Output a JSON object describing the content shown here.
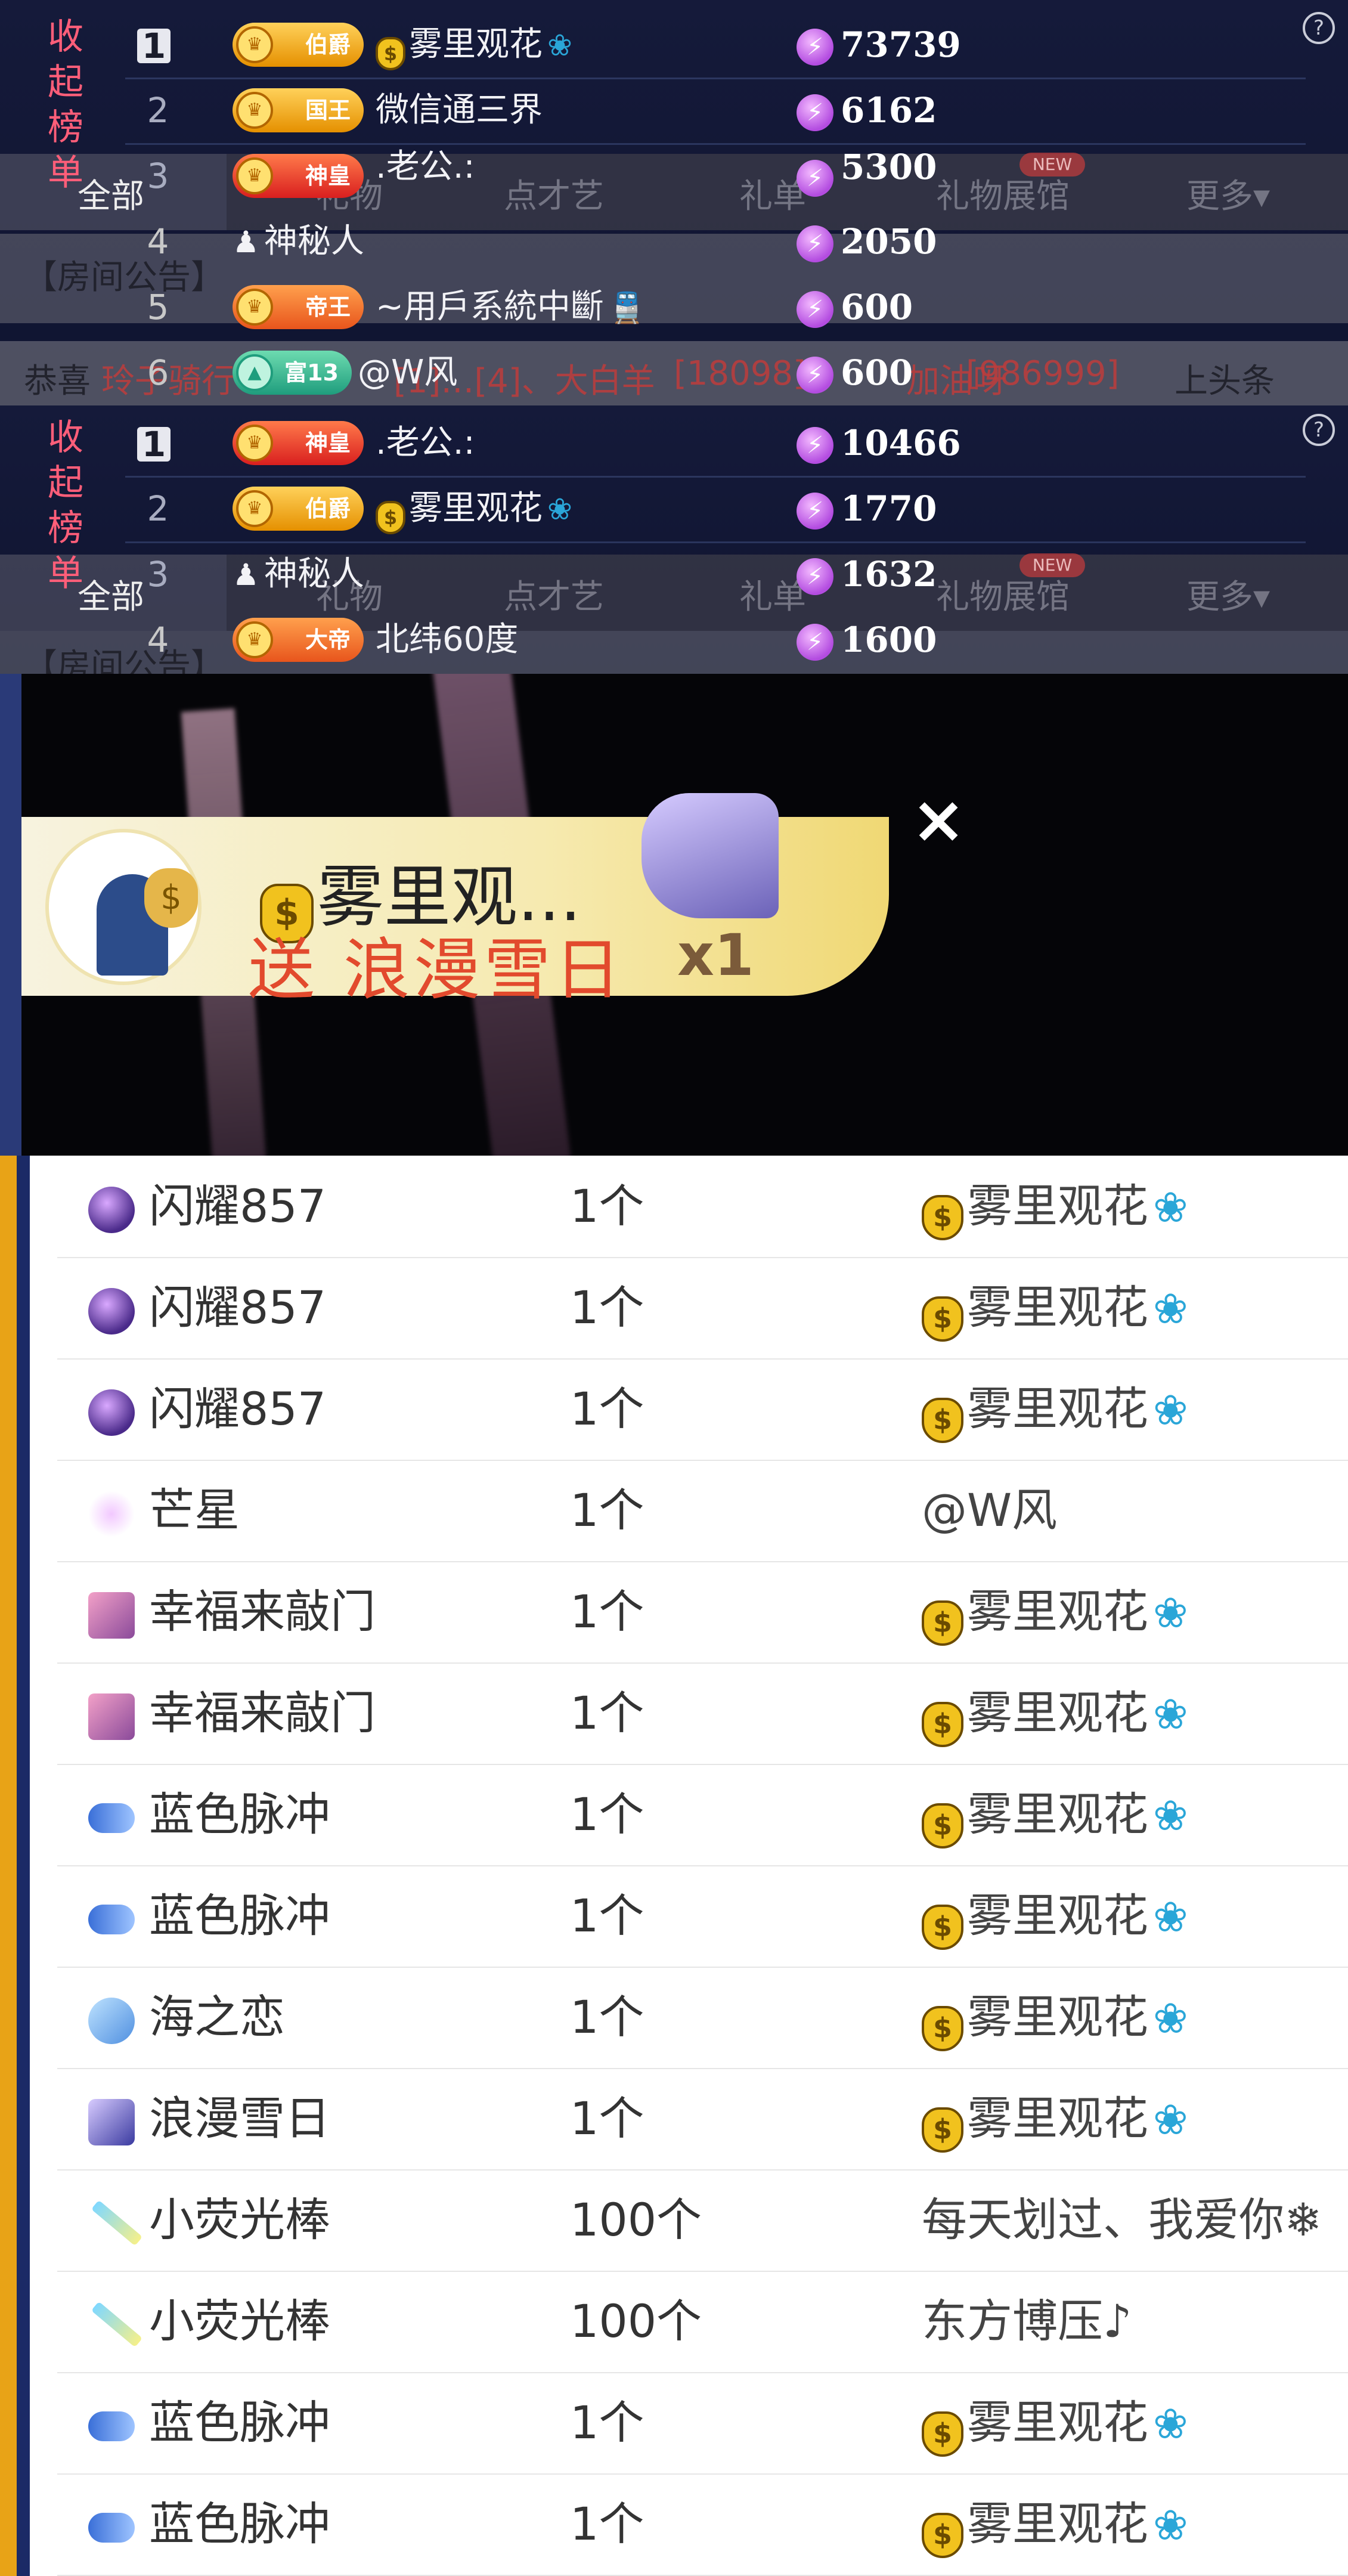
{
  "rank_panels": [
    {
      "side_label": "收起榜单",
      "help_icon": "?",
      "ghost_tabs": {
        "all": "全部",
        "t2": "礼物",
        "t3": "点才艺",
        "t4": "礼单",
        "t5": "礼物展馆",
        "new_badge": "NEW",
        "more": "更多▾"
      },
      "ghost_notice": "【房间公告】",
      "ghost_congrats": {
        "prefix": "恭喜",
        "names": "玲子骑行",
        "mid": "[1]…[4]、大白羊",
        "id1": "[18098]",
        "mid2": "加油呀",
        "id2": "[986999]",
        "suffix": "上头条"
      },
      "rows": [
        {
          "rank": "1",
          "badge": "伯爵",
          "badge_style": "gold",
          "name_prefix_icon": "moneybag",
          "name": "雾里观花",
          "name_suffix_icon": "drops",
          "score": "73739"
        },
        {
          "rank": "2",
          "badge": "国王",
          "badge_style": "gold",
          "name": "微信通三界",
          "score": "6162"
        },
        {
          "rank": "3",
          "badge": "神皇",
          "badge_style": "red",
          "name": ".老公.:",
          "score": "5300"
        },
        {
          "rank": "4",
          "badge": "",
          "name_prefix_icon": "mystery",
          "name": "神秘人",
          "score": "2050"
        },
        {
          "rank": "5",
          "badge": "帝王",
          "badge_style": "orange",
          "name": "~用戶系統中斷",
          "name_suffix_icon": "train",
          "score": "600"
        },
        {
          "rank": "6",
          "badge": "富13",
          "badge_style": "green",
          "name": "@W风",
          "score": "600"
        }
      ]
    },
    {
      "side_label": "收起榜单",
      "help_icon": "?",
      "ghost_tabs": {
        "all": "全部",
        "t2": "礼物",
        "t3": "点才艺",
        "t4": "礼单",
        "t5": "礼物展馆",
        "new_badge": "NEW",
        "more": "更多▾"
      },
      "ghost_notice": "【房间公告】",
      "rows": [
        {
          "rank": "1",
          "badge": "神皇",
          "badge_style": "red",
          "name": ".老公.:",
          "score": "10466"
        },
        {
          "rank": "2",
          "badge": "伯爵",
          "badge_style": "gold",
          "name_prefix_icon": "moneybag",
          "name": "雾里观花",
          "name_suffix_icon": "drops",
          "score": "1770"
        },
        {
          "rank": "3",
          "badge": "",
          "name_prefix_icon": "mystery",
          "name": "神秘人",
          "score": "1632"
        },
        {
          "rank": "4",
          "badge": "大帝",
          "badge_style": "orange",
          "name": "北纬60度",
          "score": "1600"
        }
      ]
    }
  ],
  "gift_banner": {
    "sender": "雾里观...",
    "gift_text": "送 浪漫雪日",
    "count": "x1",
    "close_icon": "×"
  },
  "gift_list": [
    {
      "icon": "shine-orb-icon",
      "gift": "闪耀857",
      "qty": "1个",
      "recipient": "雾里观花",
      "recipient_icons": true
    },
    {
      "icon": "shine-orb-icon",
      "gift": "闪耀857",
      "qty": "1个",
      "recipient": "雾里观花",
      "recipient_icons": true
    },
    {
      "icon": "shine-orb-icon",
      "gift": "闪耀857",
      "qty": "1个",
      "recipient": "雾里观花",
      "recipient_icons": true
    },
    {
      "icon": "sparkle-star-icon",
      "gift": "芒星",
      "qty": "1个",
      "recipient": "@W风",
      "recipient_icons": false
    },
    {
      "icon": "happy-door-icon",
      "gift": "幸福来敲门",
      "qty": "1个",
      "recipient": "雾里观花",
      "recipient_icons": true
    },
    {
      "icon": "happy-door-icon",
      "gift": "幸福来敲门",
      "qty": "1个",
      "recipient": "雾里观花",
      "recipient_icons": true
    },
    {
      "icon": "blue-car-icon",
      "gift": "蓝色脉冲",
      "qty": "1个",
      "recipient": "雾里观花",
      "recipient_icons": true
    },
    {
      "icon": "blue-car-icon",
      "gift": "蓝色脉冲",
      "qty": "1个",
      "recipient": "雾里观花",
      "recipient_icons": true
    },
    {
      "icon": "ocean-love-icon",
      "gift": "海之恋",
      "qty": "1个",
      "recipient": "雾里观花",
      "recipient_icons": true
    },
    {
      "icon": "snow-romance-icon",
      "gift": "浪漫雪日",
      "qty": "1个",
      "recipient": "雾里观花",
      "recipient_icons": true
    },
    {
      "icon": "glow-stick-icon",
      "gift": "小荧光棒",
      "qty": "100个",
      "recipient": "每天划过、我爱你❄",
      "recipient_icons": false
    },
    {
      "icon": "glow-stick-icon",
      "gift": "小荧光棒",
      "qty": "100个",
      "recipient": "东方博压♪",
      "recipient_icons": false
    },
    {
      "icon": "blue-car-icon",
      "gift": "蓝色脉冲",
      "qty": "1个",
      "recipient": "雾里观花",
      "recipient_icons": true
    },
    {
      "icon": "blue-car-icon",
      "gift": "蓝色脉冲",
      "qty": "1个",
      "recipient": "雾里观花",
      "recipient_icons": true
    }
  ],
  "colors": {
    "side_label": "#ff5e79",
    "rank_bg": "#121733",
    "coin": "#b34ce0",
    "list_bg": "#ffffff",
    "banner_gift_text": "#e24a2d"
  }
}
